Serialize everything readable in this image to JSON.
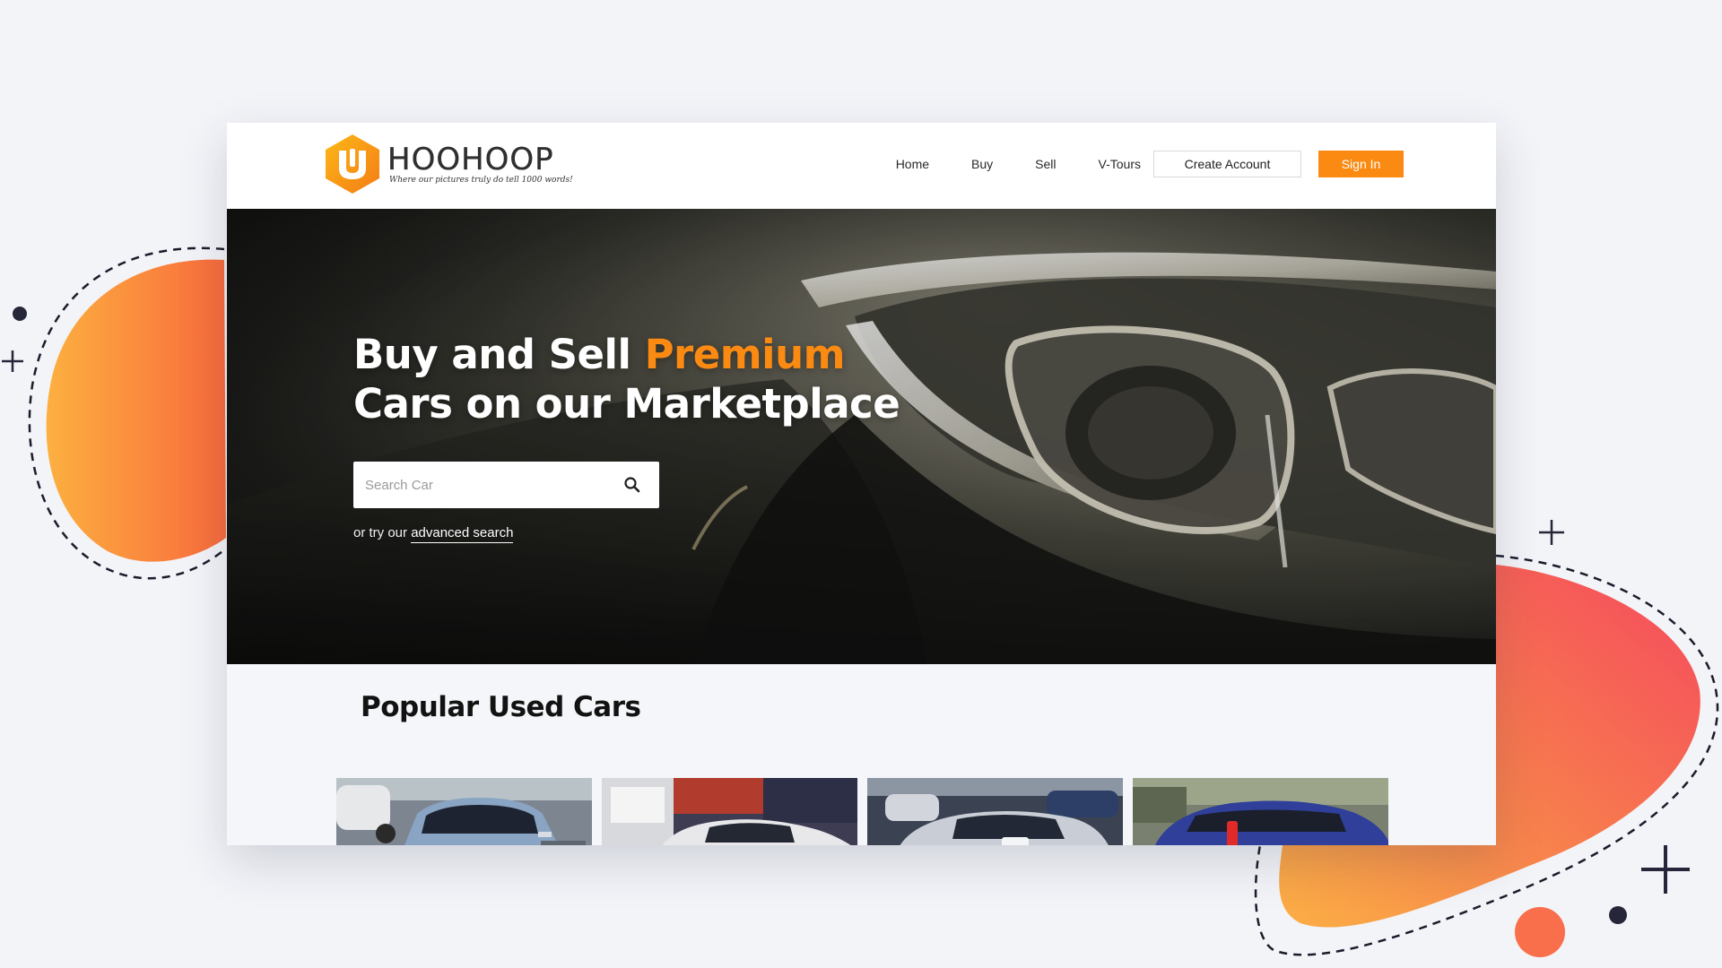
{
  "brand": {
    "name": "HOOHOOP",
    "tagline": "Where our pictures truly do tell 1000 words!",
    "accent_color": "#fb8a12"
  },
  "nav": {
    "links": [
      "Home",
      "Buy",
      "Sell",
      "V-Tours"
    ],
    "create_account": "Create Account",
    "sign_in": "Sign In"
  },
  "hero": {
    "title_part1": "Buy and Sell ",
    "title_accent": "Premium",
    "title_line2": "Cars on our Marketplace",
    "search_placeholder": "Search Car",
    "search_icon": "search-icon",
    "advanced_prefix": "or try our ",
    "advanced_link": "advanced search"
  },
  "popular": {
    "title_bold": "Popular",
    "title_rest": " Used Cars",
    "cards": [
      {
        "name": "car-silver-sedan",
        "color": "#8aa4c4"
      },
      {
        "name": "car-white-hatchback",
        "color": "#e8e8ea"
      },
      {
        "name": "car-silver-compact",
        "color": "#c9ced6"
      },
      {
        "name": "car-blue-hatchback",
        "color": "#2f3f9a"
      }
    ]
  }
}
